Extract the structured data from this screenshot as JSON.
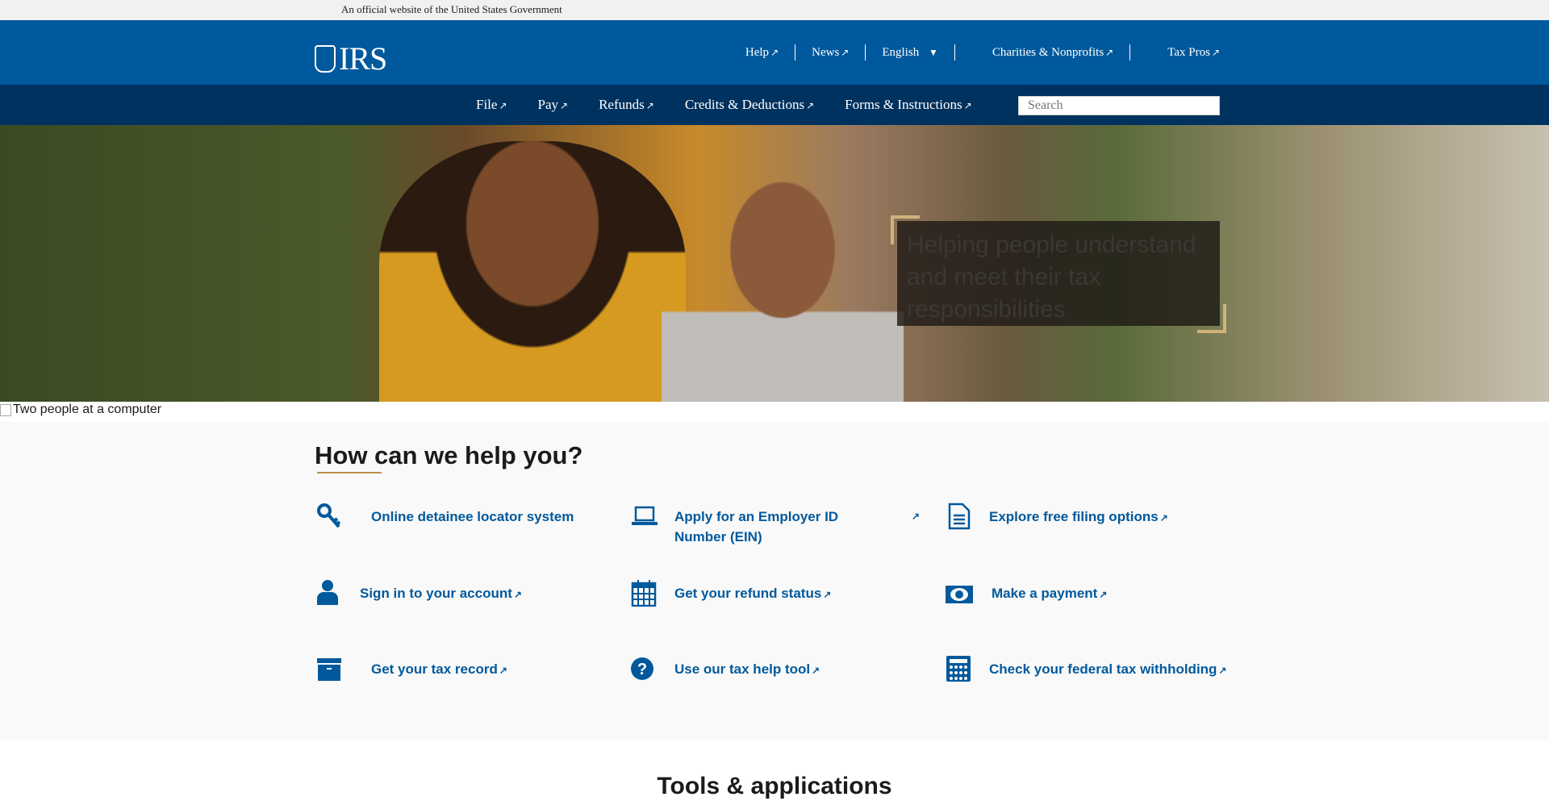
{
  "gov_banner": "An official website of the United States Government",
  "logo": "IRS",
  "utility_nav": [
    {
      "label": "Help"
    },
    {
      "label": "News"
    },
    {
      "label": "English"
    },
    {
      "label": "Charities & Nonprofits"
    },
    {
      "label": "Tax Pros"
    }
  ],
  "main_nav": [
    {
      "label": "File"
    },
    {
      "label": "Pay"
    },
    {
      "label": "Refunds"
    },
    {
      "label": "Credits & Deductions"
    },
    {
      "label": "Forms & Instructions"
    }
  ],
  "search": {
    "placeholder": "Search"
  },
  "hero": {
    "text": "Helping people understand and meet their tax responsibilities",
    "image_alt": "Two people at a computer"
  },
  "help": {
    "title": "How can we help you?",
    "tiles": [
      {
        "label": "Online detainee locator system",
        "icon": "key-icon"
      },
      {
        "label": "Apply for an Employer ID Number (EIN)",
        "icon": "laptop-icon"
      },
      {
        "label": "Explore free filing options",
        "icon": "document-icon"
      },
      {
        "label": "Sign in to your account",
        "icon": "user-icon"
      },
      {
        "label": "Get your refund status",
        "icon": "calendar-icon"
      },
      {
        "label": "Make a payment",
        "icon": "money-icon"
      },
      {
        "label": "Get your tax record",
        "icon": "archive-box-icon"
      },
      {
        "label": "Use our tax help tool",
        "icon": "question-circle-icon"
      },
      {
        "label": "Check your federal tax withholding",
        "icon": "calculator-icon"
      }
    ]
  },
  "tools_title": "Tools & applications",
  "colors": {
    "header": "#00599c",
    "nav": "#00325f",
    "link": "#00599c",
    "accent": "#bb8c4a"
  }
}
